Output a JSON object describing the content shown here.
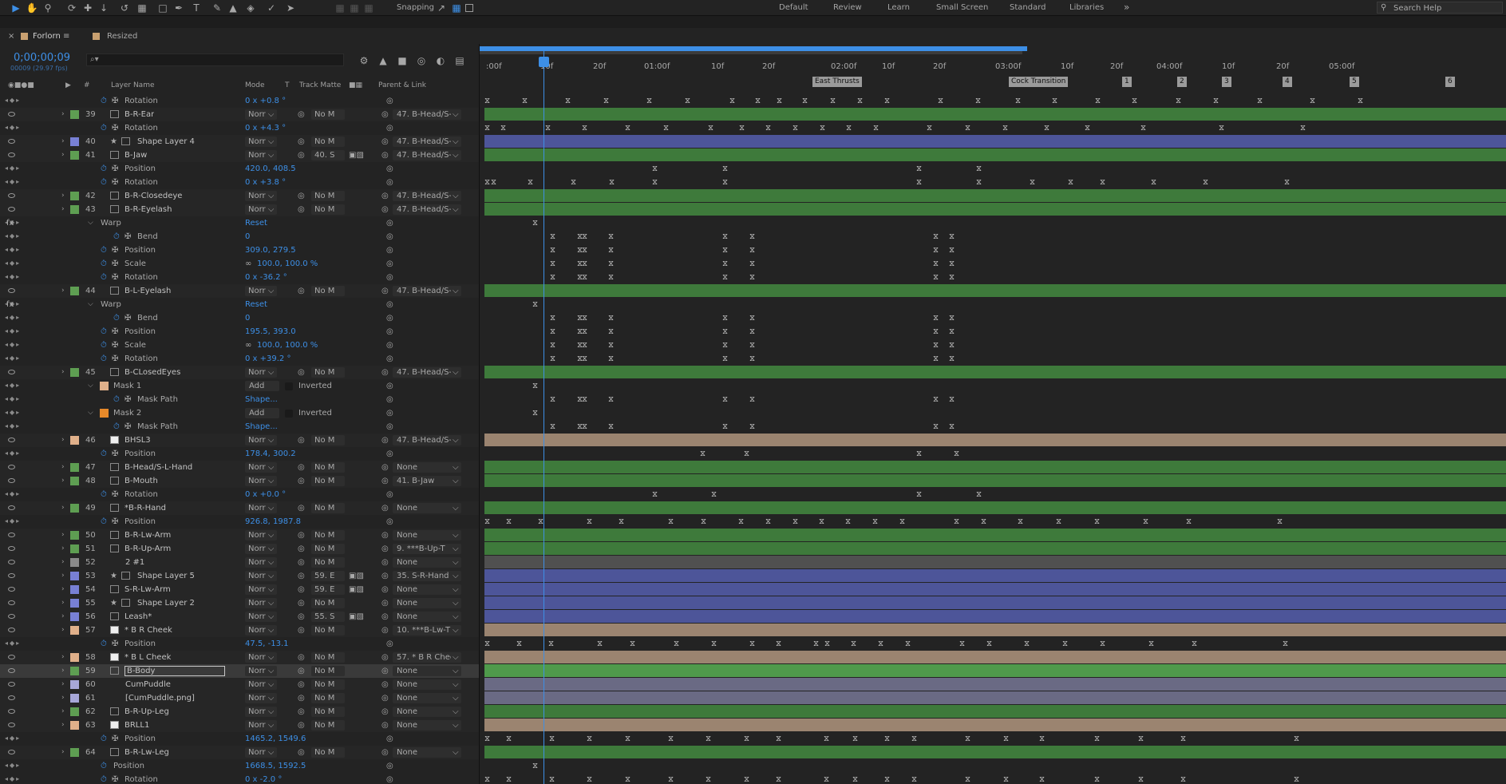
{
  "toolbar": {
    "tools": [
      "selection-tool",
      "hand-tool",
      "zoom-tool",
      "orbit-tool",
      "pan-tool",
      "dolly-tool",
      "rotation-tool",
      "pan-behind-tool",
      "rectangle-tool",
      "pen-tool",
      "type-tool",
      "brush-tool",
      "clone-stamp-tool",
      "eraser-tool",
      "roto-brush-tool",
      "puppet-pin-tool"
    ],
    "snapping_label": "Snapping",
    "workspaces": [
      "Default",
      "Review",
      "Learn",
      "Small Screen",
      "Standard",
      "Libraries"
    ],
    "more_label": "»",
    "search_placeholder": "Search Help"
  },
  "panel_tabs": {
    "active": "Forlorn",
    "inactive": "Resized"
  },
  "timeline": {
    "timecode": "0;00;00;09",
    "frames_fps": "00009 (29.97 fps)",
    "search_placeholder": "⌕▾",
    "columns": {
      "label": "#",
      "name": "Layer Name",
      "mode": "Mode",
      "t": "T",
      "track_matte": "Track Matte",
      "parent": "Parent & Link"
    },
    "ruler": [
      ":00f",
      "10f",
      "20f",
      "01:00f",
      "10f",
      "20f",
      "02:00f",
      "10f",
      "20f",
      "03:00f",
      "10f",
      "20f",
      "04:00f",
      "10f",
      "20f",
      "05:00f"
    ],
    "markers": [
      "East Thrusts",
      "Cock Transition",
      "1",
      "2",
      "3",
      "4",
      "5",
      "6"
    ]
  },
  "colors": {
    "blue": "#3d8fe6",
    "green": "#5e9e52",
    "purple": "#7880d5",
    "peach": "#e0b08a",
    "orange": "#e88a2a",
    "white": "#eaeaea",
    "grey": "#8a8a8a",
    "lavender": "#a7a7d8",
    "lightgrey": "#b8b8b8"
  },
  "rows": [
    {
      "type": "prop",
      "name": "Rotation",
      "value": "0 x +0.8 °",
      "kf": [
        0,
        47,
        101,
        149,
        203,
        251,
        307,
        339,
        366,
        398,
        433,
        467,
        501,
        568,
        615,
        665,
        711,
        765,
        811,
        866,
        913,
        968,
        1034,
        1094
      ]
    },
    {
      "type": "layer",
      "num": "39",
      "name": "B-R-Ear",
      "color": "green",
      "icon": "file",
      "mode": "Norr",
      "matte": "No M",
      "parent": "47. B-Head/S-",
      "track": "green"
    },
    {
      "type": "prop",
      "name": "Rotation",
      "value": "0 x +4.3 °",
      "kf": [
        0,
        20,
        76,
        122,
        176,
        224,
        280,
        319,
        352,
        386,
        420,
        453,
        487,
        554,
        602,
        649,
        701,
        752,
        822,
        920,
        1022
      ]
    },
    {
      "type": "layer",
      "num": "40",
      "name": "Shape Layer 4",
      "color": "purple",
      "icon": "shape",
      "mode": "Norr",
      "matte": "No M",
      "parent": "47. B-Head/S-",
      "track": "purple",
      "star": true
    },
    {
      "type": "layer",
      "num": "41",
      "name": "B-Jaw",
      "color": "green",
      "icon": "file",
      "mode": "Norr",
      "matte": "40. S",
      "parent": "47. B-Head/S-",
      "track": "green",
      "switches": true
    },
    {
      "type": "prop",
      "name": "Position",
      "value": "420.0, 408.5",
      "kf": [
        210,
        298,
        541,
        616
      ]
    },
    {
      "type": "prop",
      "name": "Rotation",
      "value": "0 x +3.8 °",
      "kf": [
        0,
        8,
        54,
        108,
        156,
        210,
        298,
        541,
        616,
        683,
        731,
        771,
        835,
        900,
        1002
      ]
    },
    {
      "type": "layer",
      "num": "42",
      "name": "B-R-Closedeye",
      "color": "green",
      "icon": "file",
      "mode": "Norr",
      "matte": "No M",
      "parent": "47. B-Head/S-",
      "track": "green"
    },
    {
      "type": "layer",
      "num": "43",
      "name": "B-R-Eyelash",
      "color": "green",
      "icon": "file",
      "mode": "Norr",
      "matte": "No M",
      "parent": "47. B-Head/S-",
      "track": "green"
    },
    {
      "type": "fx",
      "name": "Warp",
      "value": "Reset",
      "kf": [
        60
      ]
    },
    {
      "type": "prop2",
      "name": "Bend",
      "value": "0",
      "kf": [
        82,
        116,
        122,
        155,
        298,
        332,
        562,
        582
      ]
    },
    {
      "type": "prop",
      "name": "Position",
      "value": "309.0, 279.5",
      "kf": [
        82,
        116,
        122,
        155,
        298,
        332,
        562,
        582
      ]
    },
    {
      "type": "prop",
      "name": "Scale",
      "value": "100.0, 100.0 %",
      "kf": [
        82,
        116,
        122,
        155,
        298,
        332,
        562,
        582
      ]
    },
    {
      "type": "prop",
      "name": "Rotation",
      "value": "0 x -36.2 °",
      "kf": [
        82,
        116,
        122,
        155,
        298,
        332,
        562,
        582
      ]
    },
    {
      "type": "layer",
      "num": "44",
      "name": "B-L-Eyelash",
      "color": "green",
      "icon": "file",
      "mode": "Norr",
      "matte": "No M",
      "parent": "47. B-Head/S-",
      "track": "green"
    },
    {
      "type": "fx",
      "name": "Warp",
      "value": "Reset",
      "kf": [
        60
      ]
    },
    {
      "type": "prop2",
      "name": "Bend",
      "value": "0",
      "kf": [
        82,
        116,
        122,
        155,
        298,
        332,
        562,
        582
      ]
    },
    {
      "type": "prop",
      "name": "Position",
      "value": "195.5, 393.0",
      "kf": [
        82,
        116,
        122,
        155,
        298,
        332,
        562,
        582
      ]
    },
    {
      "type": "prop",
      "name": "Scale",
      "value": "100.0, 100.0 %",
      "kf": [
        82,
        116,
        122,
        155,
        298,
        332,
        562,
        582
      ]
    },
    {
      "type": "prop",
      "name": "Rotation",
      "value": "0 x +39.2 °",
      "kf": [
        82,
        116,
        122,
        155,
        298,
        332,
        562,
        582
      ]
    },
    {
      "type": "layer",
      "num": "45",
      "name": "B-CLosedEyes",
      "color": "green",
      "icon": "file",
      "mode": "Norr",
      "matte": "No M",
      "parent": "47. B-Head/S-",
      "track": "green"
    },
    {
      "type": "mask",
      "name": "Mask 1",
      "color": "peach",
      "value": "Add",
      "inverted": "Inverted",
      "kf": [
        60
      ]
    },
    {
      "type": "prop2",
      "name": "Mask Path",
      "value": "Shape...",
      "kf": [
        82,
        116,
        122,
        155,
        298,
        332,
        562,
        582
      ]
    },
    {
      "type": "mask",
      "name": "Mask 2",
      "color": "orange",
      "value": "Add",
      "inverted": "Inverted",
      "kf": [
        60
      ]
    },
    {
      "type": "prop2",
      "name": "Mask Path",
      "value": "Shape...",
      "kf": [
        82,
        116,
        122,
        155,
        298,
        332,
        562,
        582
      ]
    },
    {
      "type": "layer",
      "num": "46",
      "name": "BHSL3",
      "color": "peach",
      "icon": "white",
      "mode": "Norr",
      "matte": "No M",
      "parent": "47. B-Head/S-",
      "track": "peach"
    },
    {
      "type": "prop",
      "name": "Position",
      "value": "178.4, 300.2",
      "kf": [
        270,
        325,
        541,
        588
      ]
    },
    {
      "type": "layer",
      "num": "47",
      "name": "B-Head/S-L-Hand",
      "color": "green",
      "icon": "file",
      "mode": "Norr",
      "matte": "No M",
      "parent": "None",
      "track": "green"
    },
    {
      "type": "layer",
      "num": "48",
      "name": "B-Mouth",
      "color": "green",
      "icon": "file",
      "mode": "Norr",
      "matte": "No M",
      "parent": "41. B-Jaw",
      "track": "green"
    },
    {
      "type": "prop",
      "name": "Rotation",
      "value": "0 x +0.0 °",
      "kf": [
        210,
        284,
        541,
        616
      ]
    },
    {
      "type": "layer",
      "num": "49",
      "name": "*B-R-Hand",
      "color": "green",
      "icon": "file",
      "mode": "Norr",
      "matte": "No M",
      "parent": "None",
      "track": "green"
    },
    {
      "type": "prop",
      "name": "Position",
      "value": "926.8, 1987.8",
      "kf": [
        0,
        27,
        67,
        128,
        168,
        230,
        271,
        318,
        352,
        386,
        419,
        452,
        486,
        520,
        588,
        622,
        668,
        716,
        764,
        825,
        879,
        993
      ]
    },
    {
      "type": "layer",
      "num": "50",
      "name": "B-R-Lw-Arm",
      "color": "green",
      "icon": "file",
      "mode": "Norr",
      "matte": "No M",
      "parent": "None",
      "track": "green"
    },
    {
      "type": "layer",
      "num": "51",
      "name": "B-R-Up-Arm",
      "color": "green",
      "icon": "file",
      "mode": "Norr",
      "matte": "No M",
      "parent": "9. ***B-Up-T",
      "track": "green"
    },
    {
      "type": "layer",
      "num": "52",
      "name": "2 #1",
      "color": "grey",
      "icon": "none",
      "mode": "Norr",
      "matte": "No M",
      "parent": "None",
      "track": "grey"
    },
    {
      "type": "layer",
      "num": "53",
      "name": "Shape Layer 5",
      "color": "purple",
      "icon": "shape",
      "mode": "Norr",
      "matte": "59. E",
      "parent": "35. S-R-Hand",
      "track": "purple",
      "star": true,
      "switches": true
    },
    {
      "type": "layer",
      "num": "54",
      "name": "S-R-Lw-Arm",
      "color": "purple",
      "icon": "file",
      "mode": "Norr",
      "matte": "59. E",
      "parent": "None",
      "track": "purple",
      "switches": true
    },
    {
      "type": "layer",
      "num": "55",
      "name": "Shape Layer 2",
      "color": "purple",
      "icon": "shape",
      "mode": "Norr",
      "matte": "No M",
      "parent": "None",
      "track": "purple",
      "star": true
    },
    {
      "type": "layer",
      "num": "56",
      "name": "Leash*",
      "color": "purple",
      "icon": "shape",
      "mode": "Norr",
      "matte": "55. S",
      "parent": "None",
      "track": "purple",
      "switches": true
    },
    {
      "type": "layer",
      "num": "57",
      "name": "* B R Cheek",
      "color": "peach",
      "icon": "white",
      "mode": "Norr",
      "matte": "No M",
      "parent": "10. ***B-Lw-T",
      "track": "peach"
    },
    {
      "type": "prop",
      "name": "Position",
      "value": "47.5, -13.1",
      "kf": [
        0,
        40,
        80,
        141,
        182,
        237,
        284,
        332,
        365,
        412,
        426,
        459,
        493,
        527,
        595,
        629,
        676,
        724,
        771,
        832,
        886,
        1000
      ]
    },
    {
      "type": "layer",
      "num": "58",
      "name": "* B L Cheek",
      "color": "peach",
      "icon": "white",
      "mode": "Norr",
      "matte": "No M",
      "parent": "57. * B R Chee",
      "track": "peach"
    },
    {
      "type": "layer",
      "num": "59",
      "name": "B-Body",
      "color": "green",
      "icon": "file",
      "mode": "Norr",
      "matte": "No M",
      "parent": "None",
      "track": "greenbright",
      "selected": true
    },
    {
      "type": "layer",
      "num": "60",
      "name": "CumPuddle",
      "color": "lavender",
      "icon": "none",
      "mode": "Norr",
      "matte": "No M",
      "parent": "None",
      "track": "lavender"
    },
    {
      "type": "layer",
      "num": "61",
      "name": "[CumPuddle.png]",
      "color": "lavender",
      "icon": "none",
      "mode": "Norr",
      "matte": "No M",
      "parent": "None",
      "track": "lavender"
    },
    {
      "type": "layer",
      "num": "62",
      "name": "B-R-Up-Leg",
      "color": "green",
      "icon": "file",
      "mode": "Norr",
      "matte": "No M",
      "parent": "None",
      "track": "green"
    },
    {
      "type": "layer",
      "num": "63",
      "name": "BRLL1",
      "color": "peach",
      "icon": "white",
      "mode": "Norr",
      "matte": "No M",
      "parent": "None",
      "track": "peach"
    },
    {
      "type": "prop",
      "name": "Position",
      "value": "1465.2, 1549.6",
      "kf": [
        0,
        27,
        81,
        128,
        176,
        230,
        277,
        325,
        365,
        425,
        461,
        501,
        535,
        602,
        650,
        695,
        764,
        819,
        872,
        1014
      ]
    },
    {
      "type": "layer",
      "num": "64",
      "name": "B-R-Lw-Leg",
      "color": "green",
      "icon": "file",
      "mode": "Norr",
      "matte": "No M",
      "parent": "None",
      "track": "green"
    },
    {
      "type": "propnokf",
      "name": "Position",
      "value": "1668.5, 1592.5",
      "kf": [
        60
      ]
    },
    {
      "type": "prop",
      "name": "Rotation",
      "value": "0 x -2.0 °",
      "kf": [
        0,
        27,
        81,
        128,
        176,
        230,
        277,
        325,
        365,
        425,
        461,
        501,
        535,
        602,
        650,
        695,
        764,
        819,
        872,
        1014
      ]
    }
  ]
}
